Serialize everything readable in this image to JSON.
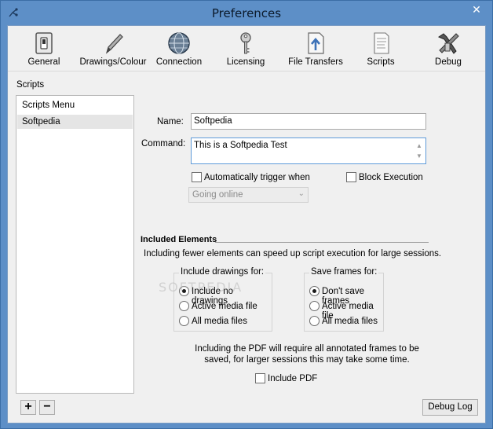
{
  "window": {
    "title": "Preferences",
    "close_glyph": "✕"
  },
  "toolbar": {
    "items": [
      {
        "label": "General",
        "icon": "switch-icon"
      },
      {
        "label": "Drawings/Colour",
        "icon": "pencil-icon"
      },
      {
        "label": "Connection",
        "icon": "globe-icon"
      },
      {
        "label": "Licensing",
        "icon": "key-icon"
      },
      {
        "label": "File Transfers",
        "icon": "upload-file-icon"
      },
      {
        "label": "Scripts",
        "icon": "script-icon"
      },
      {
        "label": "Debug",
        "icon": "tools-icon"
      }
    ]
  },
  "scripts": {
    "section_label": "Scripts",
    "list": [
      "Scripts Menu",
      "Softpedia"
    ],
    "selected": "Softpedia",
    "add_label": "+",
    "remove_label": "−",
    "debug_log_label": "Debug Log"
  },
  "details": {
    "name_label": "Name:",
    "name_value": "Softpedia",
    "command_label": "Command:",
    "command_value": "This is a Softpedia Test",
    "auto_trigger_label": "Automatically trigger when",
    "auto_trigger_checked": false,
    "block_exec_label": "Block Execution",
    "block_exec_checked": false,
    "trigger_event": "Going online"
  },
  "included": {
    "heading": "Included Elements",
    "description": "Including fewer elements can speed up script execution for large sessions.",
    "drawings_group": "Include drawings for:",
    "drawings_options": [
      "Include no drawings",
      "Active media file",
      "All media files"
    ],
    "drawings_selected": 0,
    "frames_group": "Save frames for:",
    "frames_options": [
      "Don't save frames",
      "Active media file",
      "All media files"
    ],
    "frames_selected": 0,
    "pdf_note_line1": "Including the PDF will require all annotated frames to be",
    "pdf_note_line2": "saved, for larger sessions this may take some time.",
    "include_pdf_label": "Include PDF",
    "include_pdf_checked": false
  },
  "watermark": "SOFTPEDIA"
}
